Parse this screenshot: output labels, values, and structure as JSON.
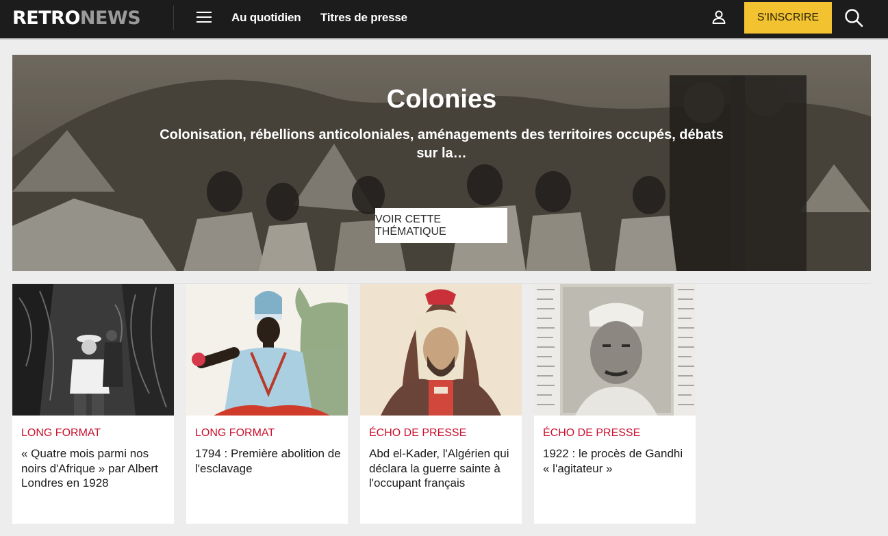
{
  "header": {
    "logo_retro": "RETRO",
    "logo_news": "NEWS",
    "nav": [
      {
        "label": "Au quotidien"
      },
      {
        "label": "Titres de presse"
      }
    ],
    "signup_label": "S'INSCRIRE",
    "icons": [
      "menu-icon",
      "user-icon",
      "search-icon"
    ]
  },
  "hero": {
    "title": "Colonies",
    "subtitle": "Colonisation, rébellions anticoloniales, aménagements des territoires occupés, débats sur la…",
    "button_label": "VOIR CETTE THÉMATIQUE"
  },
  "cards": [
    {
      "category": "LONG FORMAT",
      "title": "« Quatre mois parmi nos noirs d'Afrique » par Albert Londres en 1928"
    },
    {
      "category": "LONG FORMAT",
      "title": "1794 : Première abolition de l'esclavage"
    },
    {
      "category": "ÉCHO DE PRESSE",
      "title": "Abd el-Kader, l'Algérien qui déclara la guerre sainte à l'occupant français"
    },
    {
      "category": "ÉCHO DE PRESSE",
      "title": "1922 : le procès de Gandhi « l'agitateur »"
    }
  ],
  "colors": {
    "header_bg": "#1c1c1c",
    "accent_yellow": "#f2c230",
    "category_red": "#c8102e",
    "page_bg": "#ededed"
  }
}
